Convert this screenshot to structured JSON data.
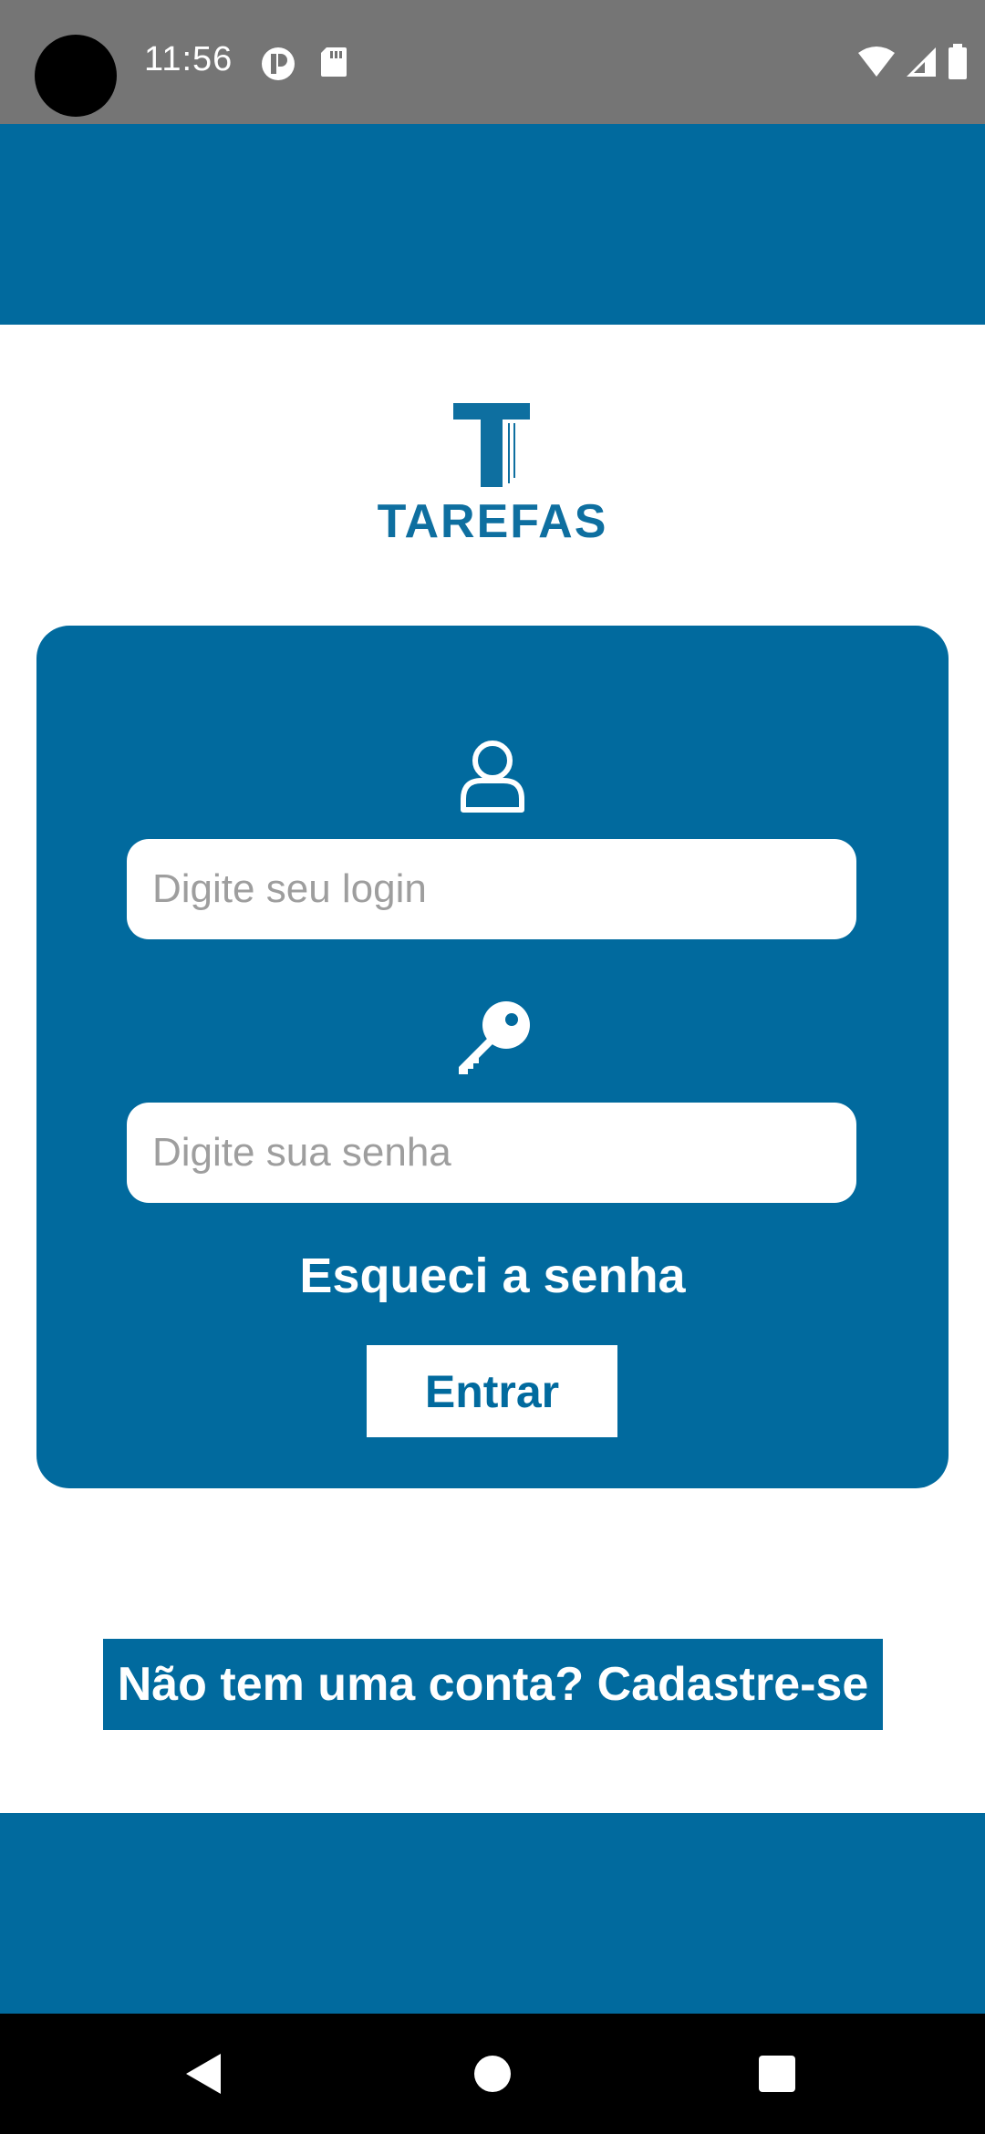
{
  "status_bar": {
    "time": "11:56",
    "icons": [
      "signal-p-icon",
      "sd-card-icon",
      "wifi-icon",
      "cellular-icon",
      "battery-icon"
    ]
  },
  "logo": {
    "text": "TAREFAS",
    "color": "#0e6fa0"
  },
  "login_form": {
    "login_placeholder": "Digite seu login",
    "login_value": "",
    "senha_placeholder": "Digite sua senha",
    "senha_value": "",
    "forgot_label": "Esqueci a senha",
    "submit_label": "Entrar"
  },
  "signup": {
    "label": "Não tem uma conta? Cadastre-se"
  },
  "nav_bar": {
    "buttons": [
      "back-icon",
      "home-icon",
      "recents-icon"
    ]
  },
  "colors": {
    "primary": "#016a9e",
    "status_bar": "#757575",
    "nav_bar": "#000000",
    "background": "#ffffff"
  }
}
